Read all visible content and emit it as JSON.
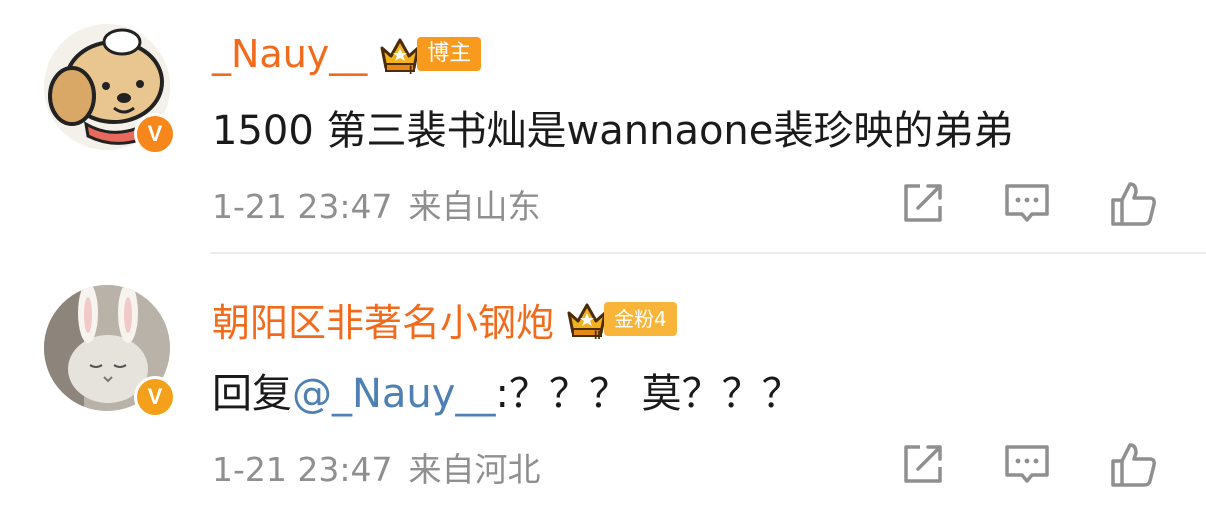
{
  "comments": [
    {
      "username": "_Nauy__",
      "badge": "博主",
      "badge_level": "I",
      "verified_icon": "v-verified-icon",
      "text_prefix": "",
      "mention": "",
      "text": "1500 第三裴书灿是wannaone裴珍映的弟弟",
      "time": "1-21 23:47",
      "location": "来自山东",
      "actions": [
        "share-icon",
        "comment-icon",
        "like-icon"
      ]
    },
    {
      "username": "朝阳区非著名小钢炮",
      "badge": "金粉4",
      "badge_level": "II",
      "verified_icon": "v-verified-icon",
      "text_prefix": "回复",
      "mention": "@_Nauy__",
      "text": ":？？？ 莫？？？",
      "time": "1-21 23:47",
      "location": "来自河北",
      "actions": [
        "share-icon",
        "comment-icon",
        "like-icon"
      ]
    }
  ],
  "colors": {
    "username": "#f26b1d",
    "mention": "#4f80b3",
    "meta": "#8f8f8f",
    "verified_orange": "#f7861b",
    "badge_bloger": "#f79a1e",
    "badge_fan": "#f8b53a"
  }
}
